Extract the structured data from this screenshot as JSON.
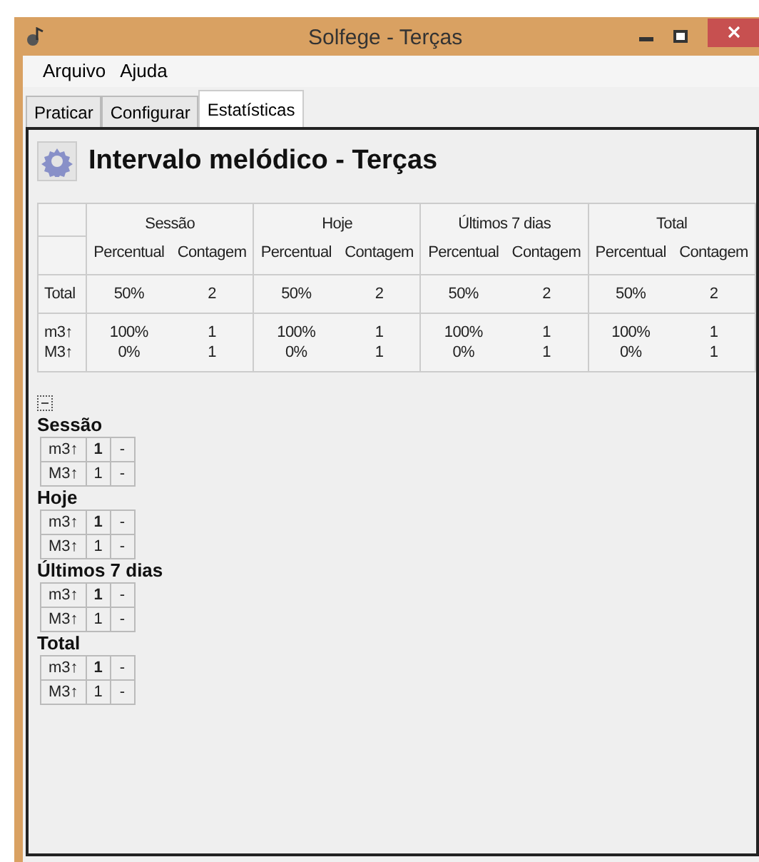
{
  "window": {
    "title": "Solfege - Terças"
  },
  "menu": [
    {
      "label": "Arquivo"
    },
    {
      "label": "Ajuda"
    }
  ],
  "tabs": [
    {
      "label": "Praticar",
      "selected": false
    },
    {
      "label": "Configurar",
      "selected": false
    },
    {
      "label": "Estatísticas",
      "selected": true
    }
  ],
  "heading": "Intervalo melódico - Terças",
  "table": {
    "groups": [
      "Sessão",
      "Hoje",
      "Últimos 7 dias",
      "Total"
    ],
    "subcolumns": [
      [
        "Percentual",
        "Contagem"
      ],
      [
        "Percentual",
        "Contagem"
      ],
      [
        "Percentual",
        "Contagem"
      ],
      [
        "Percentual",
        "Contagem"
      ]
    ],
    "rows": [
      {
        "label": [
          "Total"
        ],
        "cells": [
          [
            "50%"
          ],
          [
            "2"
          ],
          [
            "50%"
          ],
          [
            "2"
          ],
          [
            "50%"
          ],
          [
            "2"
          ],
          [
            "50%"
          ],
          [
            "2"
          ]
        ]
      },
      {
        "label": [
          "m3↑",
          "M3↑"
        ],
        "cells": [
          [
            "100%",
            "0%"
          ],
          [
            "1",
            "1"
          ],
          [
            "100%",
            "0%"
          ],
          [
            "1",
            "1"
          ],
          [
            "100%",
            "0%"
          ],
          [
            "1",
            "1"
          ],
          [
            "100%",
            "0%"
          ],
          [
            "1",
            "1"
          ]
        ]
      }
    ]
  },
  "tree": {
    "expanded": true,
    "sections": [
      {
        "title": "Sessão",
        "rows": [
          {
            "label": "m3↑",
            "count": "1",
            "bold": true,
            "mark": "-"
          },
          {
            "label": "M3↑",
            "count": "1",
            "bold": false,
            "mark": "-"
          }
        ]
      },
      {
        "title": "Hoje",
        "rows": [
          {
            "label": "m3↑",
            "count": "1",
            "bold": true,
            "mark": "-"
          },
          {
            "label": "M3↑",
            "count": "1",
            "bold": false,
            "mark": "-"
          }
        ]
      },
      {
        "title": "Últimos 7 dias",
        "rows": [
          {
            "label": "m3↑",
            "count": "1",
            "bold": true,
            "mark": "-"
          },
          {
            "label": "M3↑",
            "count": "1",
            "bold": false,
            "mark": "-"
          }
        ]
      },
      {
        "title": "Total",
        "rows": [
          {
            "label": "m3↑",
            "count": "1",
            "bold": true,
            "mark": "-"
          },
          {
            "label": "M3↑",
            "count": "1",
            "bold": false,
            "mark": "-"
          }
        ]
      }
    ]
  }
}
